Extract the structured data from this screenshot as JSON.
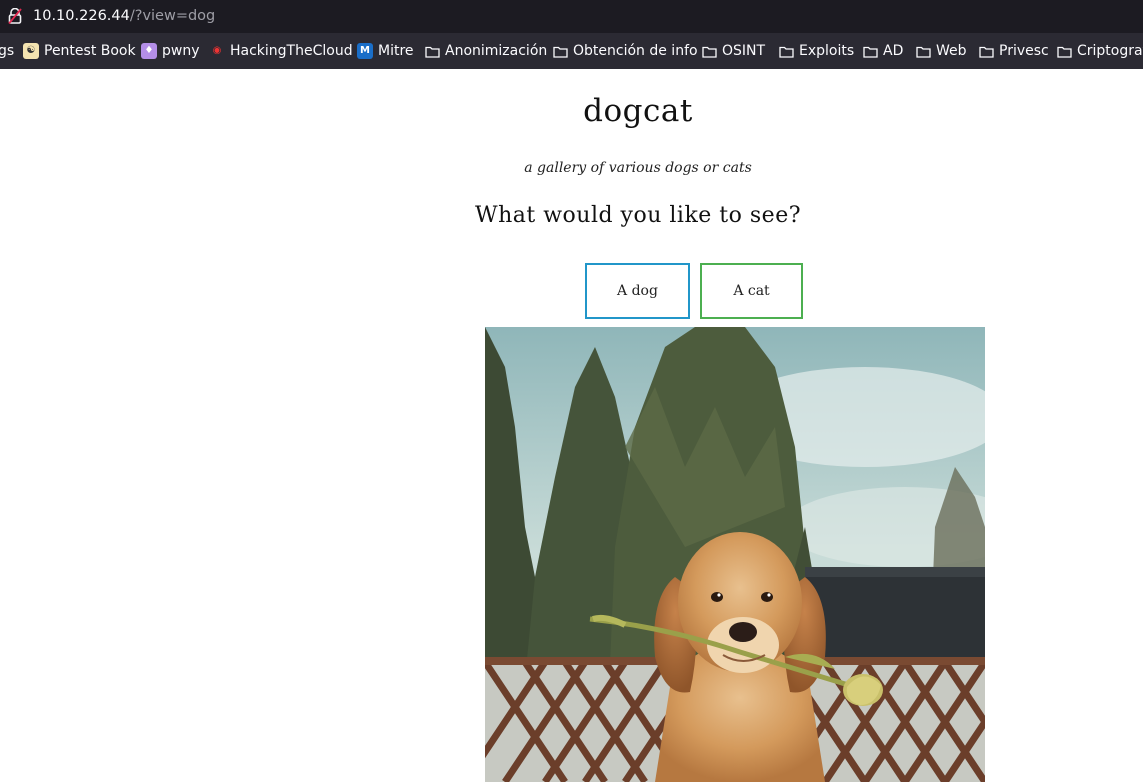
{
  "browser": {
    "url_host": "10.10.226.44",
    "url_path": "/?view=dog",
    "bookmarks": [
      {
        "label": "gs",
        "icon": "none"
      },
      {
        "label": "Pentest Book",
        "icon": "pentest-book-favicon"
      },
      {
        "label": "pwny",
        "icon": "pwny-favicon"
      },
      {
        "label": "HackingTheCloud",
        "icon": "hackingthecloud-favicon"
      },
      {
        "label": "Mitre",
        "icon": "mitre-favicon"
      },
      {
        "label": "Anonimización",
        "icon": "folder-icon"
      },
      {
        "label": "Obtención de info",
        "icon": "folder-icon"
      },
      {
        "label": "OSINT",
        "icon": "folder-icon"
      },
      {
        "label": "Exploits",
        "icon": "folder-icon"
      },
      {
        "label": "AD",
        "icon": "folder-icon"
      },
      {
        "label": "Web",
        "icon": "folder-icon"
      },
      {
        "label": "Privesc",
        "icon": "folder-icon"
      },
      {
        "label": "Criptograf",
        "icon": "folder-icon"
      }
    ]
  },
  "page": {
    "title": "dogcat",
    "subtitle": "a gallery of various dogs or cats",
    "question": "What would you like to see?",
    "buttons": {
      "dog_label": "A dog",
      "cat_label": "A cat"
    },
    "colors": {
      "dog_border": "#2196c9",
      "cat_border": "#4caf50"
    }
  }
}
